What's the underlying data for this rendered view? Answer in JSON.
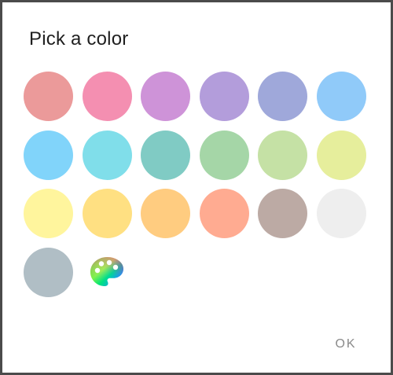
{
  "dialog": {
    "title": "Pick a color",
    "ok_label": "OK"
  },
  "swatches": [
    {
      "name": "red",
      "color": "#EB9A9A"
    },
    {
      "name": "pink",
      "color": "#F48FB1"
    },
    {
      "name": "purple",
      "color": "#CE93D8"
    },
    {
      "name": "deep-purple",
      "color": "#B39DDB"
    },
    {
      "name": "indigo",
      "color": "#9FA8DA"
    },
    {
      "name": "blue",
      "color": "#90CAF9"
    },
    {
      "name": "light-blue",
      "color": "#81D4FA"
    },
    {
      "name": "cyan",
      "color": "#80DEEA"
    },
    {
      "name": "teal",
      "color": "#80CBC4"
    },
    {
      "name": "green",
      "color": "#A5D6A7"
    },
    {
      "name": "light-green",
      "color": "#C5E1A5"
    },
    {
      "name": "lime",
      "color": "#E6EE9C"
    },
    {
      "name": "yellow",
      "color": "#FFF59D"
    },
    {
      "name": "amber",
      "color": "#FFE082"
    },
    {
      "name": "orange",
      "color": "#FFCC80"
    },
    {
      "name": "deep-orange",
      "color": "#FFAB91"
    },
    {
      "name": "brown",
      "color": "#BCAAA4"
    },
    {
      "name": "grey",
      "color": "#EEEEEE"
    },
    {
      "name": "blue-grey",
      "color": "#B0BEC5"
    }
  ],
  "custom_color": {
    "icon": "palette-icon"
  }
}
